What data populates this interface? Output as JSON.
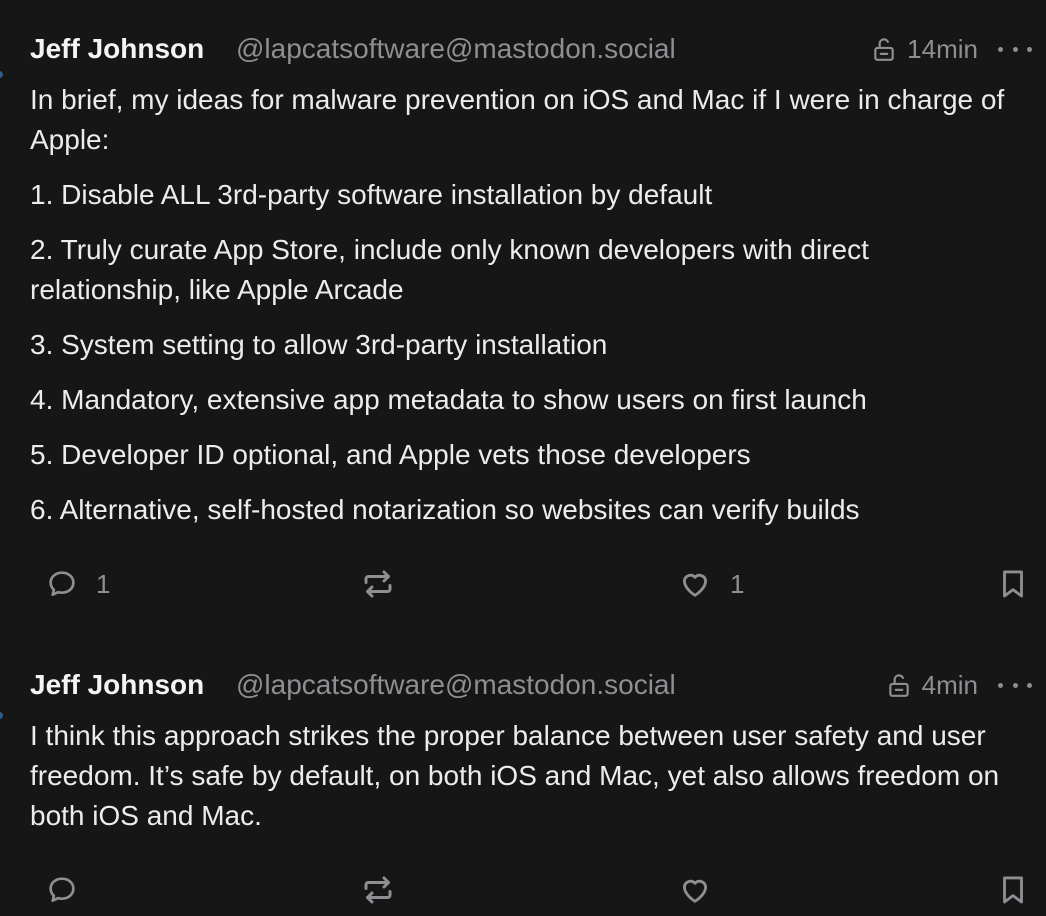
{
  "colors": {
    "background": "#161616",
    "text": "#ececec",
    "muted": "#8e8e93",
    "thread_indicator": "#2a5f8c"
  },
  "posts": [
    {
      "author": "Jeff Johnson",
      "handle": "@lapcatsoftware@mastodon.social",
      "visibility_icon": "unlocked-icon",
      "time": "14min",
      "paragraphs": [
        "In brief, my ideas for malware prevention on iOS and Mac if I were in charge of Apple:",
        "1. Disable ALL 3rd-party software installation by default",
        "2. Truly curate App Store, include only known developers with direct relationship, like Apple Arcade",
        "3. System setting to allow 3rd-party installation",
        "4. Mandatory, extensive app metadata to show users on first launch",
        "5. Developer ID optional, and Apple vets those developers",
        "6. Alternative, self-hosted notarization so websites can verify builds"
      ],
      "replies": "1",
      "favourites": "1"
    },
    {
      "author": "Jeff Johnson",
      "handle": "@lapcatsoftware@mastodon.social",
      "visibility_icon": "unlocked-icon",
      "time": "4min",
      "paragraphs": [
        "I think this approach strikes the proper balance between user safety and user freedom. It’s safe by default, on both iOS and Mac, yet also allows freedom on both iOS and Mac."
      ],
      "replies": "",
      "favourites": ""
    }
  ]
}
